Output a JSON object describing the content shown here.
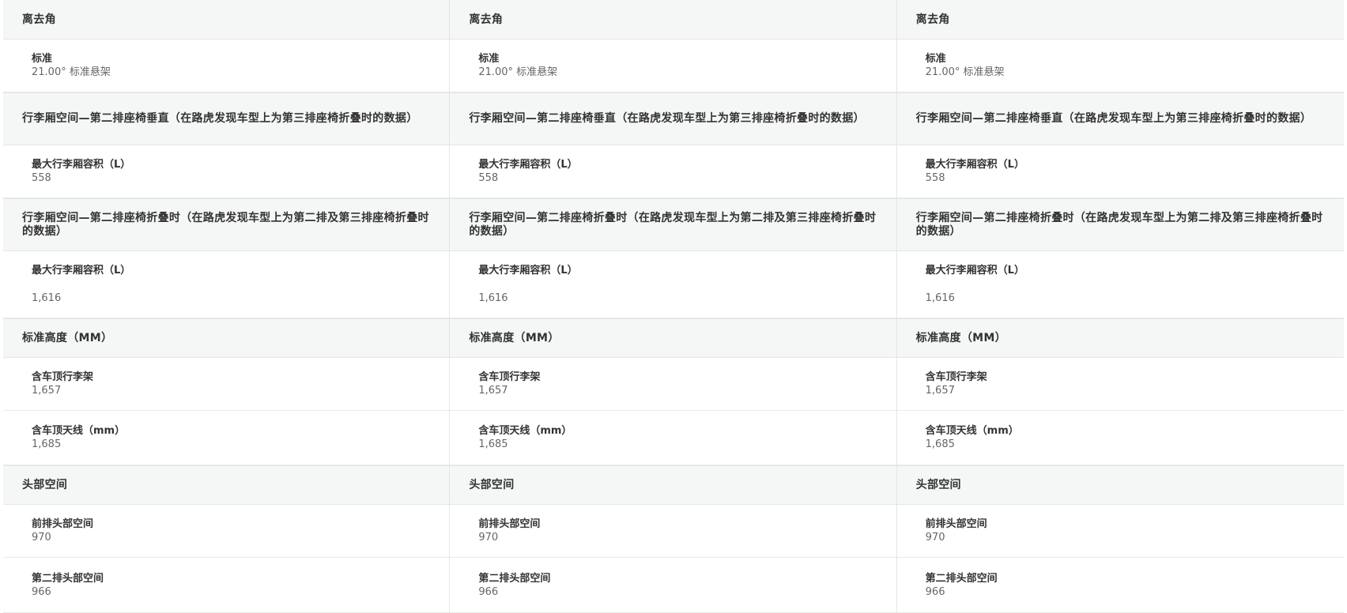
{
  "columns": [
    {
      "departure_angle": {
        "heading": "离去角",
        "standard_label": "标准",
        "standard_value": "21.00° 标准悬架"
      },
      "luggage_upright": {
        "heading": "行李厢空间—第二排座椅垂直（在路虎发现车型上为第三排座椅折叠时的数据）",
        "max_label": "最大行李厢容积（L）",
        "max_value": "558"
      },
      "luggage_folded": {
        "heading": "行李厢空间—第二排座椅折叠时（在路虎发现车型上为第二排及第三排座椅折叠时的数据）",
        "max_label": "最大行李厢容积（L）",
        "max_value": "1,616"
      },
      "standard_height": {
        "heading": "标准高度（MM）",
        "roof_rack_label": "含车顶行李架",
        "roof_rack_value": "1,657",
        "antenna_label": "含车顶天线（mm）",
        "antenna_value": "1,685"
      },
      "headroom": {
        "heading": "头部空间",
        "front_label": "前排头部空间",
        "front_value": "970",
        "second_label": "第二排头部空间",
        "second_value": "966"
      }
    },
    {
      "departure_angle": {
        "heading": "离去角",
        "standard_label": "标准",
        "standard_value": "21.00° 标准悬架"
      },
      "luggage_upright": {
        "heading": "行李厢空间—第二排座椅垂直（在路虎发现车型上为第三排座椅折叠时的数据）",
        "max_label": "最大行李厢容积（L）",
        "max_value": "558"
      },
      "luggage_folded": {
        "heading": "行李厢空间—第二排座椅折叠时（在路虎发现车型上为第二排及第三排座椅折叠时的数据）",
        "max_label": "最大行李厢容积（L）",
        "max_value": "1,616"
      },
      "standard_height": {
        "heading": "标准高度（MM）",
        "roof_rack_label": "含车顶行李架",
        "roof_rack_value": "1,657",
        "antenna_label": "含车顶天线（mm）",
        "antenna_value": "1,685"
      },
      "headroom": {
        "heading": "头部空间",
        "front_label": "前排头部空间",
        "front_value": "970",
        "second_label": "第二排头部空间",
        "second_value": "966"
      }
    },
    {
      "departure_angle": {
        "heading": "离去角",
        "standard_label": "标准",
        "standard_value": "21.00° 标准悬架"
      },
      "luggage_upright": {
        "heading": "行李厢空间—第二排座椅垂直（在路虎发现车型上为第三排座椅折叠时的数据）",
        "max_label": "最大行李厢容积（L）",
        "max_value": "558"
      },
      "luggage_folded": {
        "heading": "行李厢空间—第二排座椅折叠时（在路虎发现车型上为第二排及第三排座椅折叠时的数据）",
        "max_label": "最大行李厢容积（L）",
        "max_value": "1,616"
      },
      "standard_height": {
        "heading": "标准高度（MM）",
        "roof_rack_label": "含车顶行李架",
        "roof_rack_value": "1,657",
        "antenna_label": "含车顶天线（mm）",
        "antenna_value": "1,685"
      },
      "headroom": {
        "heading": "头部空间",
        "front_label": "前排头部空间",
        "front_value": "970",
        "second_label": "第二排头部空间",
        "second_value": "966"
      }
    }
  ]
}
